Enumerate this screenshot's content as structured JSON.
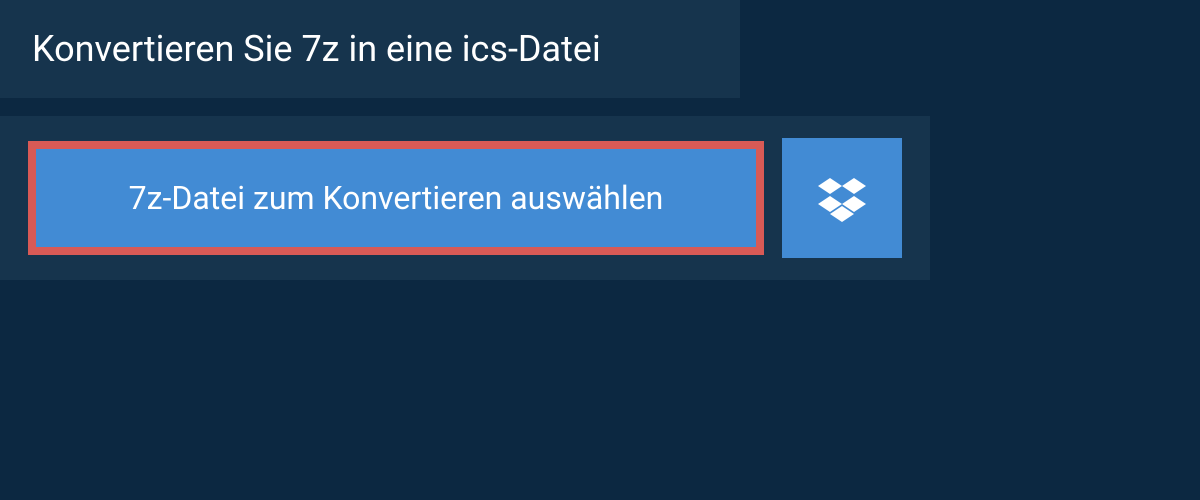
{
  "header": {
    "title": "Konvertieren Sie 7z in eine ics-Datei"
  },
  "upload": {
    "select_button_label": "7z-Datei zum Konvertieren auswählen",
    "dropbox_icon_name": "dropbox-icon"
  },
  "colors": {
    "background": "#0c2841",
    "panel": "#16344d",
    "button": "#428bd4",
    "highlight_border": "#d85a56",
    "text": "#ffffff"
  }
}
